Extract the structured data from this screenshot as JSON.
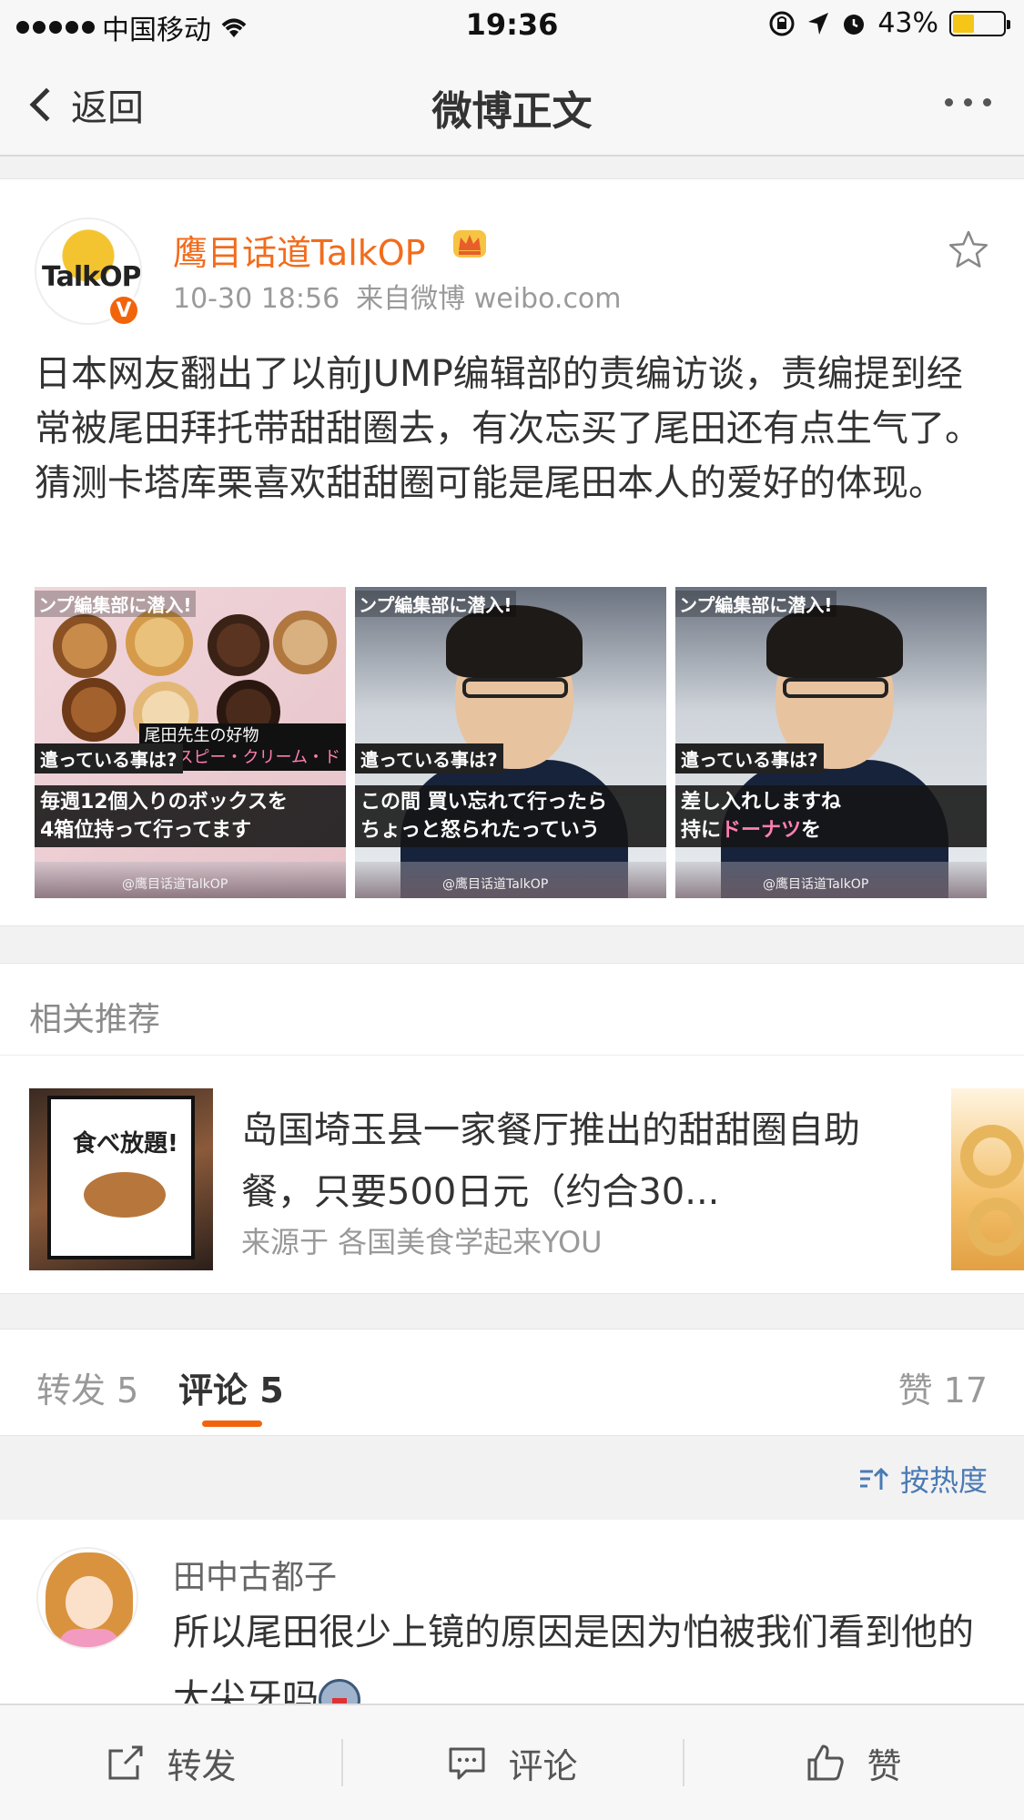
{
  "status_bar": {
    "carrier": "中国移动",
    "time": "19:36",
    "battery_percent": "43%",
    "battery_level": 0.43
  },
  "nav": {
    "back_label": "返回",
    "title": "微博正文"
  },
  "post": {
    "avatar_text": "TalkOP",
    "verified_badge": "V",
    "user_name": "鹰目话道TalkOP",
    "time": "10-30 18:56",
    "source": "来自微博 weibo.com",
    "text": "日本网友翻出了以前JUMP编辑部的责编访谈，责编提到经常被尾田拜托带甜甜圈去，有次忘买了尾田还有点生气了。猜测卡塔库栗喜欢甜甜圈可能是尾田本人的爱好的体现。",
    "images": [
      {
        "top_caption": "ンプ編集部に潜入!",
        "question": "遣っている事は?",
        "tag_line1": "尾田先生の好物",
        "tag_line2": "クリスピー・クリーム・ド",
        "sub_line1": "毎週12個入りのボックスを",
        "sub_line2": "4箱位持って行ってます",
        "watermark": "@鹰目话道TalkOP"
      },
      {
        "top_caption": "ンプ編集部に潜入!",
        "question": "遣っている事は?",
        "sub_line1": "この間 買い忘れて行ったら",
        "sub_line2": "ちょっと怒られたっていう",
        "watermark": "@鹰目话道TalkOP"
      },
      {
        "top_caption": "ンプ編集部に潜入!",
        "question": "遣っている事は?",
        "sub_line1": "差し入れしますね",
        "sub_line2_prefix": "持に",
        "sub_line2_highlight": "ドーナツ",
        "sub_line2_suffix": "を",
        "watermark": "@鹰目话道TalkOP"
      }
    ]
  },
  "related": {
    "header": "相关推荐",
    "sign_title": "食べ放題!",
    "title": "岛国埼玉县一家餐厅推出的甜甜圈自助餐，只要500日元（约合30...",
    "source": "来源于 各国美食学起来YOU"
  },
  "tabs": {
    "repost": "转发 5",
    "comment": "评论 5",
    "like": "赞 17"
  },
  "sort": {
    "label": "按热度"
  },
  "comment": {
    "user": "田中古都子",
    "text": "所以尾田很少上镜的原因是因为怕被我们看到他的大尖牙吗"
  },
  "toolbar": {
    "repost": "转发",
    "comment": "评论",
    "like": "赞"
  },
  "colors": {
    "accent_orange": "#f2640c",
    "username_orange": "#f26c1c",
    "link_blue": "#4a7ab5"
  }
}
